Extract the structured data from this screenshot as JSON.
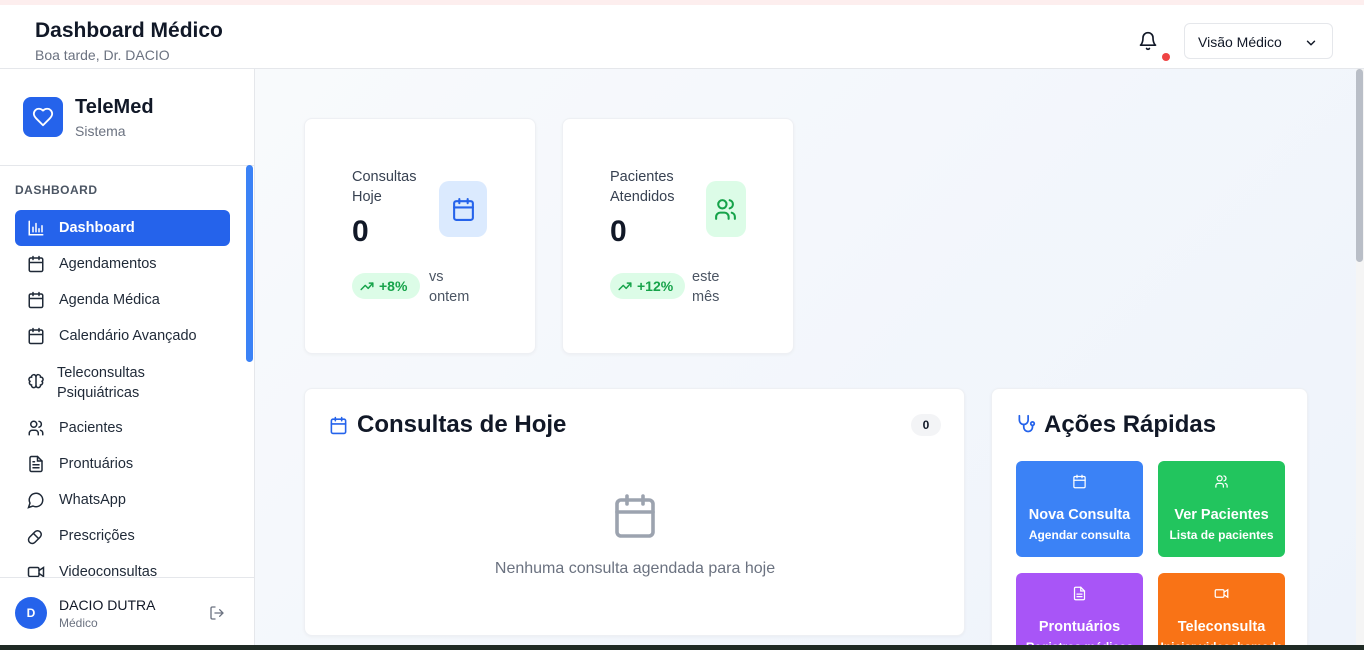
{
  "header": {
    "title": "Dashboard Médico",
    "subtitle": "Boa tarde, Dr. DACIO",
    "notification_icon": "bell-icon",
    "view_selector": "Visão Médico"
  },
  "sidebar": {
    "brand": "TeleMed",
    "brand_sub": "Sistema",
    "section": "DASHBOARD",
    "items": [
      {
        "label": "Dashboard",
        "icon": "bar-chart-icon",
        "active": true
      },
      {
        "label": "Agendamentos",
        "icon": "calendar-icon"
      },
      {
        "label": "Agenda Médica",
        "icon": "calendar-icon"
      },
      {
        "label": "Calendário Avançado",
        "icon": "calendar-icon"
      },
      {
        "label": "Teleconsultas Psiquiátricas",
        "icon": "brain-icon"
      },
      {
        "label": "Pacientes",
        "icon": "users-icon"
      },
      {
        "label": "Prontuários",
        "icon": "file-text-icon"
      },
      {
        "label": "WhatsApp",
        "icon": "message-circle-icon"
      },
      {
        "label": "Prescrições",
        "icon": "pill-icon"
      },
      {
        "label": "Videoconsultas",
        "icon": "video-icon"
      }
    ],
    "user": {
      "initial": "D",
      "name": "DACIO DUTRA",
      "role": "Médico"
    }
  },
  "stats": [
    {
      "label": "Consultas Hoje",
      "value": "0",
      "change": "+8%",
      "note": "vs ontem",
      "color": "#2563eb"
    },
    {
      "label": "Pacientes Atendidos",
      "value": "0",
      "change": "+12%",
      "note": "este mês",
      "color": "#16a34a"
    }
  ],
  "today": {
    "title": "Consultas de Hoje",
    "count": "0",
    "empty": "Nenhuma consulta agendada para hoje"
  },
  "quick_actions": {
    "title": "Ações Rápidas",
    "items": [
      {
        "title": "Nova Consulta",
        "subtitle": "Agendar consulta",
        "color": "#3b82f6",
        "icon": "calendar-icon"
      },
      {
        "title": "Ver Pacientes",
        "subtitle": "Lista de pacientes",
        "color": "#22c55e",
        "icon": "users-icon"
      },
      {
        "title": "Prontuários",
        "subtitle": "Registros médicos",
        "color": "#a855f7",
        "icon": "file-text-icon"
      },
      {
        "title": "Teleconsulta",
        "subtitle": "Iniciar videochamada",
        "color": "#f97316",
        "icon": "video-icon"
      }
    ]
  }
}
